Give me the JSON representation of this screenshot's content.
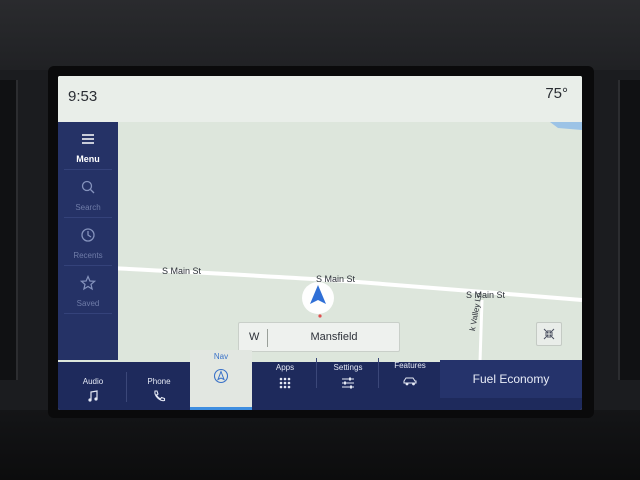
{
  "status": {
    "time": "9:53",
    "temperature": "75°"
  },
  "side_menu": {
    "items": [
      {
        "id": "menu",
        "label": "Menu",
        "icon": "hamburger-icon",
        "active": true
      },
      {
        "id": "search",
        "label": "Search",
        "icon": "search-icon",
        "active": false
      },
      {
        "id": "recents",
        "label": "Recents",
        "icon": "clock-icon",
        "active": false
      },
      {
        "id": "saved",
        "label": "Saved",
        "icon": "star-icon",
        "active": false
      }
    ]
  },
  "map": {
    "roads": [
      {
        "label": "S Main St"
      },
      {
        "label": "S Main St"
      },
      {
        "label": "S Main St"
      },
      {
        "label": "k Valley Ln"
      }
    ],
    "heading_direction": "W",
    "current_city": "Mansfield",
    "colors": {
      "land": "#dde6dc",
      "road": "#ffffff",
      "arrow": "#2f6fd6",
      "water": "#9cc3e6"
    }
  },
  "bottom_bar": {
    "tabs": [
      {
        "label": "Audio",
        "icon": "music-note-icon"
      },
      {
        "label": "Phone",
        "icon": "phone-icon"
      },
      {
        "label": "Nav",
        "icon": "nav-icon",
        "active": true
      },
      {
        "label": "Apps",
        "icon": "apps-grid-icon"
      },
      {
        "label": "Settings",
        "icon": "sliders-icon"
      },
      {
        "label": "Features",
        "icon": "car-icon"
      }
    ],
    "fuel_economy_label": "Fuel Economy"
  }
}
